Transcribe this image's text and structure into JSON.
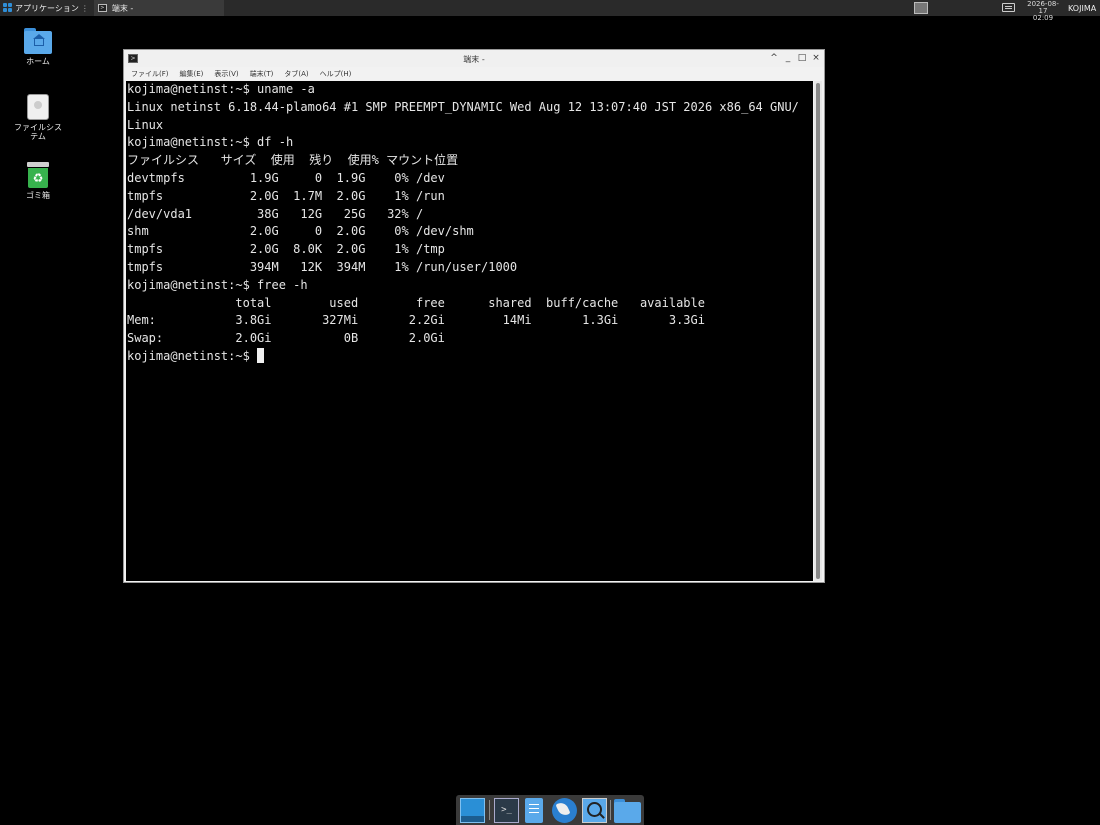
{
  "top_panel": {
    "apps_label": "アプリケーション",
    "task_label": "端末 -",
    "clock_date": "2026-08-17",
    "clock_time": "02:09",
    "user": "KOJIMA"
  },
  "desktop": {
    "icons": [
      {
        "label": "ホーム",
        "icon": "home-folder-icon"
      },
      {
        "label": "ファイルシステム",
        "icon": "filesystem-drive-icon"
      },
      {
        "label": "ゴミ箱",
        "icon": "trash-icon"
      }
    ]
  },
  "window": {
    "title": "端末 -",
    "menu": [
      "ファイル(F)",
      "編集(E)",
      "表示(V)",
      "端末(T)",
      "タブ(A)",
      "ヘルプ(H)"
    ],
    "buttons": {
      "shade": "^",
      "minimize": "_",
      "maximize": "□",
      "close": "×"
    }
  },
  "terminal": {
    "lines": [
      "kojima@netinst:~$ uname -a",
      "Linux netinst 6.18.44-plamo64 #1 SMP PREEMPT_DYNAMIC Wed Aug 12 13:07:40 JST 2026 x86_64 GNU/",
      "Linux",
      "kojima@netinst:~$ df -h",
      "ファイルシス   サイズ  使用  残り  使用% マウント位置",
      "devtmpfs         1.9G     0  1.9G    0% /dev",
      "tmpfs            2.0G  1.7M  2.0G    1% /run",
      "/dev/vda1         38G   12G   25G   32% /",
      "shm              2.0G     0  2.0G    0% /dev/shm",
      "tmpfs            2.0G  8.0K  2.0G    1% /tmp",
      "tmpfs            394M   12K  394M    1% /run/user/1000",
      "kojima@netinst:~$ free -h",
      "               total        used        free      shared  buff/cache   available",
      "Mem:           3.8Gi       327Mi       2.2Gi        14Mi       1.3Gi       3.3Gi",
      "Swap:          2.0Gi          0B       2.0Gi"
    ],
    "prompt": "kojima@netinst:~$ "
  },
  "dock": {
    "items": [
      "show-desktop-icon",
      "terminal-icon",
      "file-manager-icon",
      "web-browser-icon",
      "app-finder-icon",
      "folder-icon"
    ]
  }
}
